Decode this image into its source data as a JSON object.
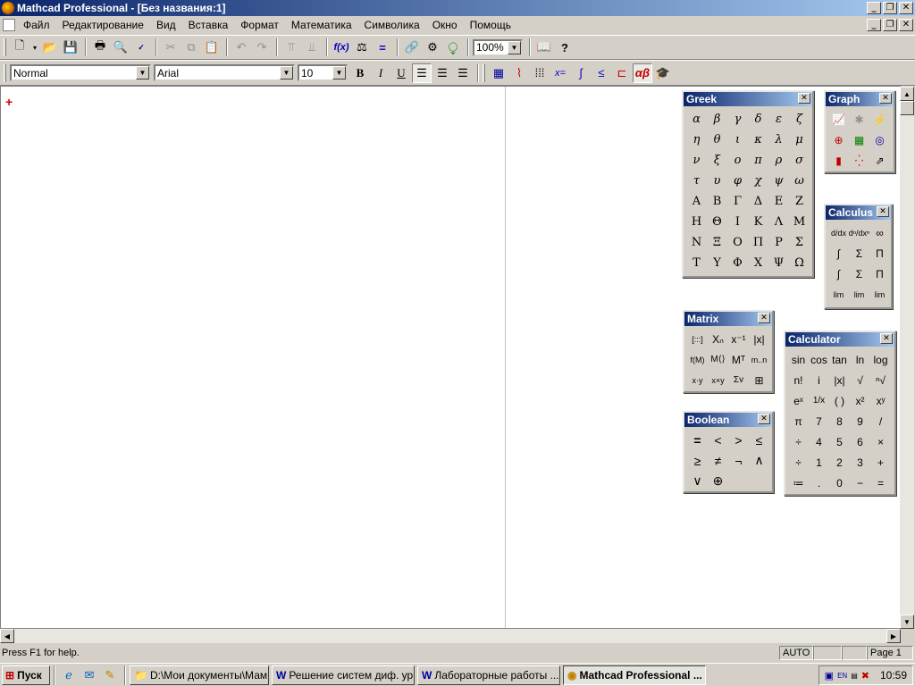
{
  "window": {
    "title": "Mathcad Professional - [Без названия:1]"
  },
  "menu": [
    "Файл",
    "Редактирование",
    "Вид",
    "Вставка",
    "Формат",
    "Математика",
    "Символика",
    "Окно",
    "Помощь"
  ],
  "toolbar": {
    "zoom": "100%"
  },
  "format_bar": {
    "style": "Normal",
    "font": "Arial",
    "size": "10",
    "bold": "B",
    "italic": "I",
    "underline": "U"
  },
  "greek": {
    "title": "Greek",
    "lower": [
      "α",
      "β",
      "γ",
      "δ",
      "ε",
      "ζ",
      "η",
      "θ",
      "ι",
      "κ",
      "λ",
      "μ",
      "ν",
      "ξ",
      "ο",
      "π",
      "ρ",
      "σ",
      "τ",
      "υ",
      "φ",
      "χ",
      "ψ",
      "ω"
    ],
    "upper": [
      "Α",
      "Β",
      "Γ",
      "Δ",
      "Ε",
      "Ζ",
      "Η",
      "Θ",
      "Ι",
      "Κ",
      "Λ",
      "Μ",
      "Ν",
      "Ξ",
      "Ο",
      "Π",
      "Ρ",
      "Σ",
      "Τ",
      "Υ",
      "Φ",
      "Χ",
      "Ψ",
      "Ω"
    ]
  },
  "graph": {
    "title": "Graph"
  },
  "calculus": {
    "title": "Calculus",
    "items": [
      "d/dx",
      "dⁿ/dxⁿ",
      "∞",
      "∫",
      "Σ",
      "Π",
      "∫",
      "Σ",
      "Π",
      "lim",
      "lim",
      "lim"
    ]
  },
  "matrix": {
    "title": "Matrix",
    "items": [
      "[:::]",
      "Xₙ",
      "x⁻¹",
      "|x|",
      "f(M)",
      "M⟨⟩",
      "Mᵀ",
      "m..n",
      "x·y",
      "x×y",
      "Σv",
      "⊞"
    ]
  },
  "boolean": {
    "title": "Boolean",
    "items": [
      "=",
      "<",
      ">",
      "≤",
      "≥",
      "≠",
      "¬",
      "∧",
      "∨",
      "⊕"
    ]
  },
  "calculator": {
    "title": "Calculator",
    "items": [
      "sin",
      "cos",
      "tan",
      "ln",
      "log",
      "n!",
      "i",
      "|x|",
      "√",
      "ⁿ√",
      "eˣ",
      "1/x",
      "( )",
      "x²",
      "xʸ",
      "π",
      "7",
      "8",
      "9",
      "/",
      "÷",
      "4",
      "5",
      "6",
      "×",
      "÷",
      "1",
      "2",
      "3",
      "+",
      "≔",
      ".",
      "0",
      "−",
      "="
    ]
  },
  "status": {
    "help": "Press F1 for help.",
    "mode": "AUTO",
    "page": "Page 1"
  },
  "taskbar": {
    "start": "Пуск",
    "items": [
      "D:\\Мои документы\\Мам...",
      "Решение систем диф. ур...",
      "Лабораторные работы ....",
      "Mathcad Professional ..."
    ],
    "clock": "10:59"
  }
}
